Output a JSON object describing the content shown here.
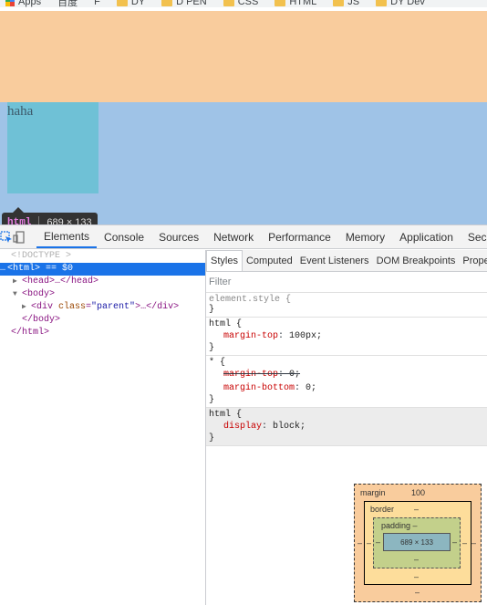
{
  "bookmarks": [
    "Apps",
    "百度",
    "F",
    "DY",
    "D PEN",
    "CSS",
    "HTML",
    "JS",
    "DY Dev"
  ],
  "page": {
    "child_text": "haha"
  },
  "tooltip": {
    "tag": "html",
    "dims": "689 × 133"
  },
  "devtools": {
    "tabs": [
      "Elements",
      "Console",
      "Sources",
      "Network",
      "Performance",
      "Memory",
      "Application",
      "Secur"
    ],
    "active_tab": "Elements",
    "dom": {
      "doctype": "<!DOCTYPE >",
      "html_line": "<html> == $0",
      "head_line": "<head>…</head>",
      "body_open": "<body>",
      "div_tag": "<div ",
      "div_attr": "class",
      "div_eq": "=",
      "div_val": "\"parent\"",
      "div_close": ">…</div>",
      "body_close": "</body>",
      "html_close": "</html>",
      "dots": "…"
    },
    "styles_tabs": [
      "Styles",
      "Computed",
      "Event Listeners",
      "DOM Breakpoints",
      "Propert"
    ],
    "filter_placeholder": "Filter",
    "rules": [
      {
        "selector": "element.style {",
        "props": [],
        "close": "}"
      },
      {
        "selector": "html {",
        "props": [
          {
            "name": "margin-top",
            "value": "100px;"
          }
        ],
        "close": "}"
      },
      {
        "selector": "* {",
        "props": [
          {
            "name": "margin-top",
            "value": "0;"
          },
          {
            "name": "margin-bottom",
            "value": "0;"
          }
        ],
        "close": "}"
      },
      {
        "selector": "html {",
        "props": [
          {
            "name": "display",
            "value": "block;"
          }
        ],
        "close": "}"
      }
    ],
    "box_model": {
      "margin_label": "margin",
      "margin_top": "100",
      "margin_bottom": "–",
      "margin_left": "–",
      "margin_right": "–",
      "border_label": "border",
      "border_top": "–",
      "border_bottom": "–",
      "border_left": "–",
      "border_right": "–",
      "padding_label": "padding –",
      "padding_bottom": "–",
      "padding_left": "–",
      "padding_right": "–",
      "content": "689 × 133"
    }
  },
  "colors": {
    "margin": "#f9cc9d",
    "viewport": "#9fc3e7",
    "child": "#6fc1d6",
    "selected": "#1a73e8"
  }
}
